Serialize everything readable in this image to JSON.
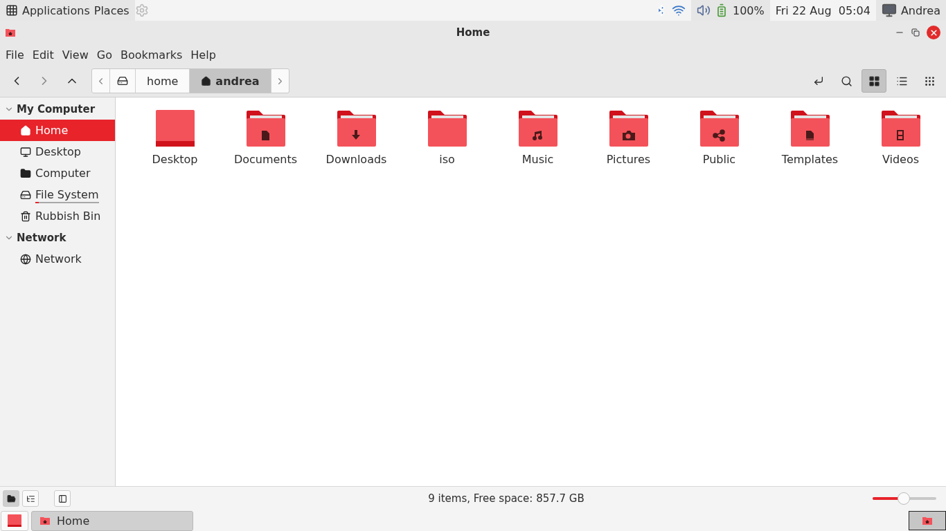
{
  "top_panel": {
    "menus": [
      "Applications",
      "Places"
    ],
    "battery": "100%",
    "clock": "Fri 22 Aug  05:04",
    "user": "Andrea"
  },
  "window": {
    "title": "Home"
  },
  "menubar": [
    "File",
    "Edit",
    "View",
    "Go",
    "Bookmarks",
    "Help"
  ],
  "breadcrumb": [
    {
      "kind": "drive",
      "selected": false
    },
    {
      "kind": "folder",
      "label": "home",
      "selected": false
    },
    {
      "kind": "home",
      "label": "andrea",
      "selected": true
    }
  ],
  "view_buttons": [
    {
      "kind": "icons",
      "selected": true
    },
    {
      "kind": "list",
      "selected": false
    },
    {
      "kind": "compact",
      "selected": false
    }
  ],
  "sidebar": [
    {
      "title": "My Computer",
      "expanded": true,
      "items": [
        {
          "kind": "home",
          "label": "Home",
          "selected": true
        },
        {
          "kind": "desktop",
          "label": "Desktop",
          "selected": false
        },
        {
          "kind": "computer",
          "label": "Computer",
          "selected": false
        },
        {
          "kind": "drive",
          "label": "File System",
          "selected": false,
          "level": 0.05
        },
        {
          "kind": "trash",
          "label": "Rubbish Bin",
          "selected": false
        }
      ]
    },
    {
      "title": "Network",
      "expanded": true,
      "items": [
        {
          "kind": "network",
          "label": "Network",
          "selected": false
        }
      ]
    }
  ],
  "files": [
    {
      "kind": "desktop",
      "name": "Desktop"
    },
    {
      "kind": "documents",
      "name": "Documents"
    },
    {
      "kind": "downloads",
      "name": "Downloads"
    },
    {
      "kind": "plain",
      "name": "iso"
    },
    {
      "kind": "music",
      "name": "Music"
    },
    {
      "kind": "pictures",
      "name": "Pictures"
    },
    {
      "kind": "public",
      "name": "Public"
    },
    {
      "kind": "templates",
      "name": "Templates"
    },
    {
      "kind": "videos",
      "name": "Videos"
    }
  ],
  "status_bar": {
    "pane_buttons": [
      {
        "kind": "places",
        "selected": true
      },
      {
        "kind": "tree",
        "selected": false
      }
    ],
    "text": "9 items, Free space: 857.7 GB",
    "zoom": {
      "level": 0.49
    }
  },
  "taskbar": {
    "windows": [
      {
        "label": "Home",
        "selected": true
      }
    ]
  }
}
